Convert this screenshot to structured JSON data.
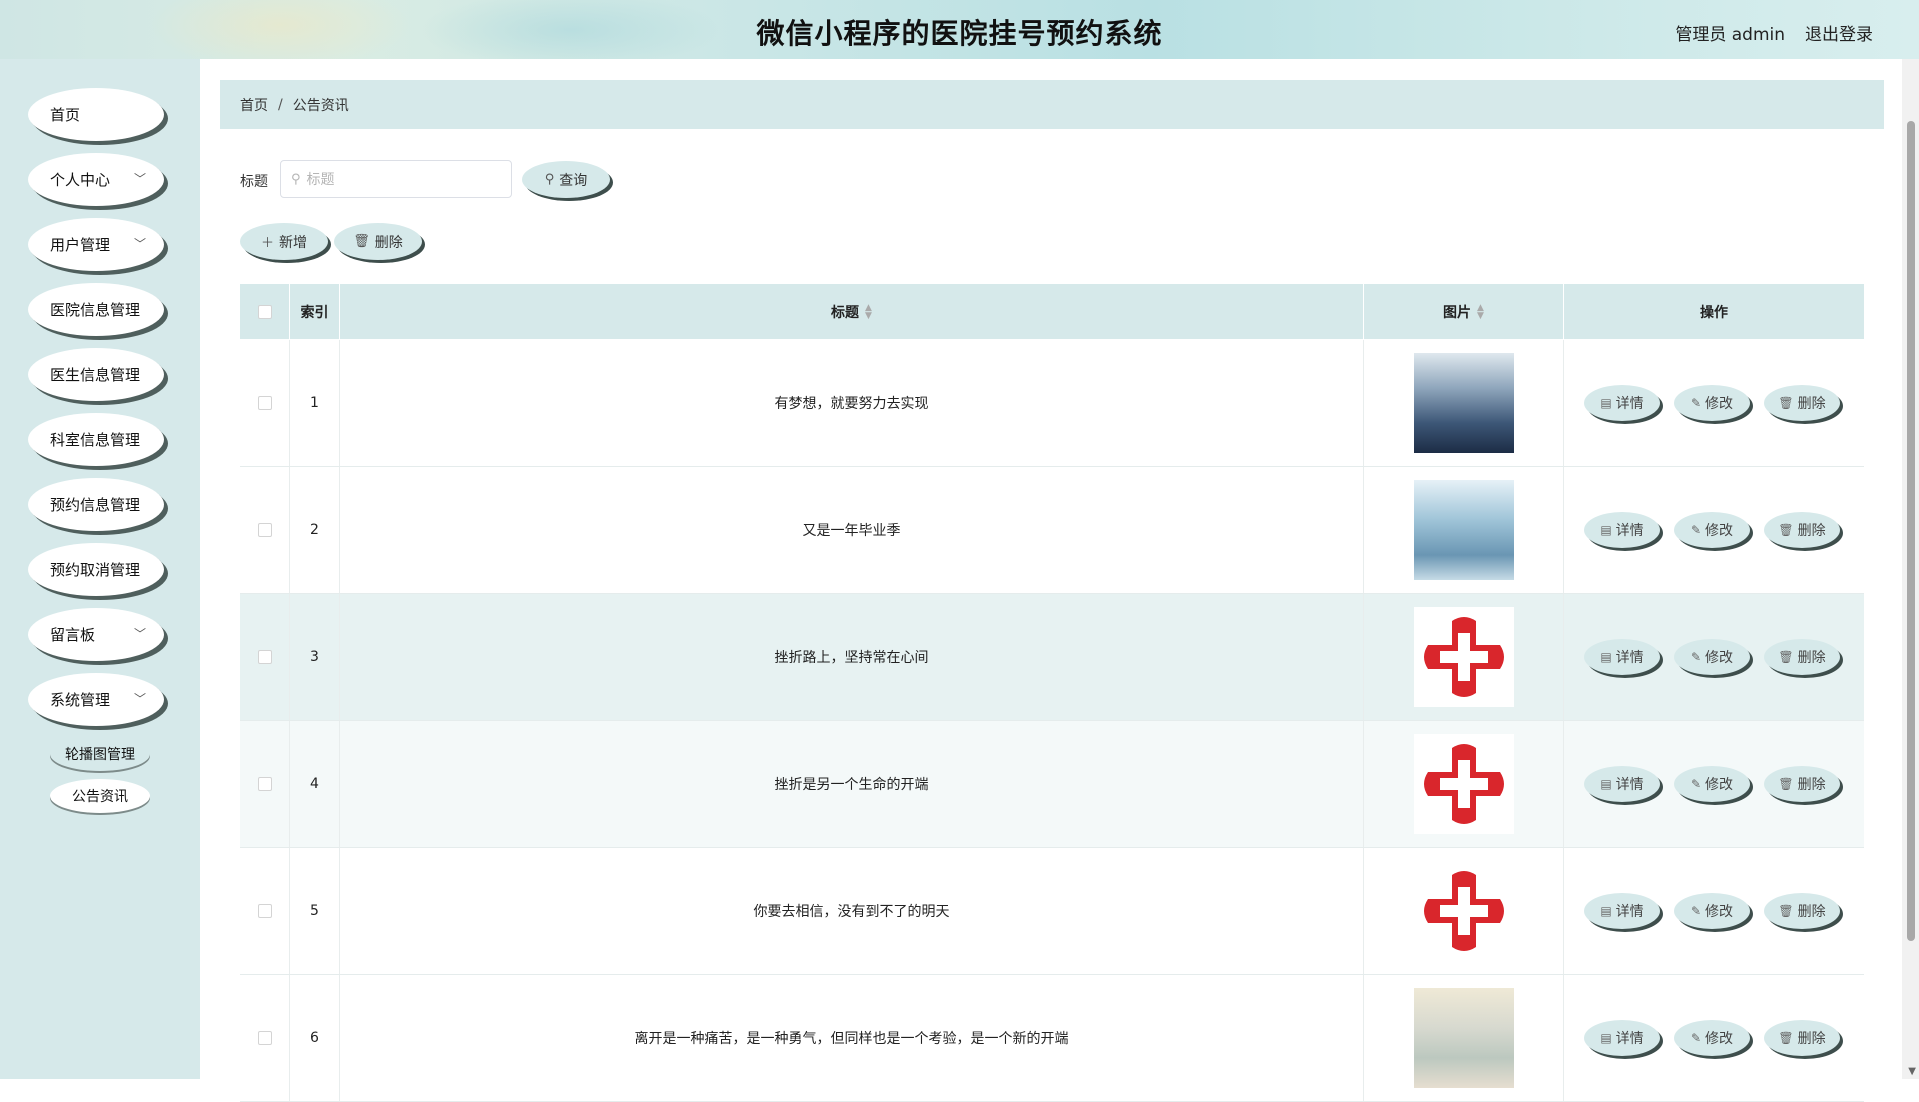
{
  "header": {
    "title": "微信小程序的医院挂号预约系统",
    "admin": "管理员 admin",
    "logout": "退出登录"
  },
  "sidebar": {
    "items": [
      {
        "label": "首页",
        "has_children": false
      },
      {
        "label": "个人中心",
        "has_children": true
      },
      {
        "label": "用户管理",
        "has_children": true
      },
      {
        "label": "医院信息管理",
        "has_children": false
      },
      {
        "label": "医生信息管理",
        "has_children": false
      },
      {
        "label": "科室信息管理",
        "has_children": false
      },
      {
        "label": "预约信息管理",
        "has_children": false
      },
      {
        "label": "预约取消管理",
        "has_children": false
      },
      {
        "label": "留言板",
        "has_children": true
      },
      {
        "label": "系统管理",
        "has_children": true
      }
    ],
    "sub_items": [
      {
        "label": "轮播图管理"
      },
      {
        "label": "公告资讯"
      }
    ]
  },
  "breadcrumb": {
    "home": "首页",
    "separator": "/",
    "current": "公告资讯"
  },
  "search": {
    "label": "标题",
    "placeholder": "标题",
    "button": "查询"
  },
  "toolbar": {
    "add": "新增",
    "delete": "删除"
  },
  "table": {
    "columns": {
      "index": "索引",
      "title": "标题",
      "image": "图片",
      "actions": "操作"
    },
    "actions": {
      "detail": "详情",
      "edit": "修改",
      "delete": "删除"
    },
    "rows": [
      {
        "index": "1",
        "title": "有梦想，就要努力去实现",
        "image": "waiting-room-photo"
      },
      {
        "index": "2",
        "title": "又是一年毕业季",
        "image": "operating-room-photo"
      },
      {
        "index": "3",
        "title": "挫折路上，坚持常在心间",
        "image": "red-cross-logo"
      },
      {
        "index": "4",
        "title": "挫折是另一个生命的开端",
        "image": "red-cross-logo"
      },
      {
        "index": "5",
        "title": "你要去相信，没有到不了的明天",
        "image": "red-cross-logo"
      },
      {
        "index": "6",
        "title": "离开是一种痛苦，是一种勇气，但同样也是一个考验，是一个新的开端",
        "image": "hospital-corridor-photo"
      }
    ]
  },
  "colors": {
    "accent": "#d6e9ea",
    "shadow": "#3e4e4c"
  }
}
